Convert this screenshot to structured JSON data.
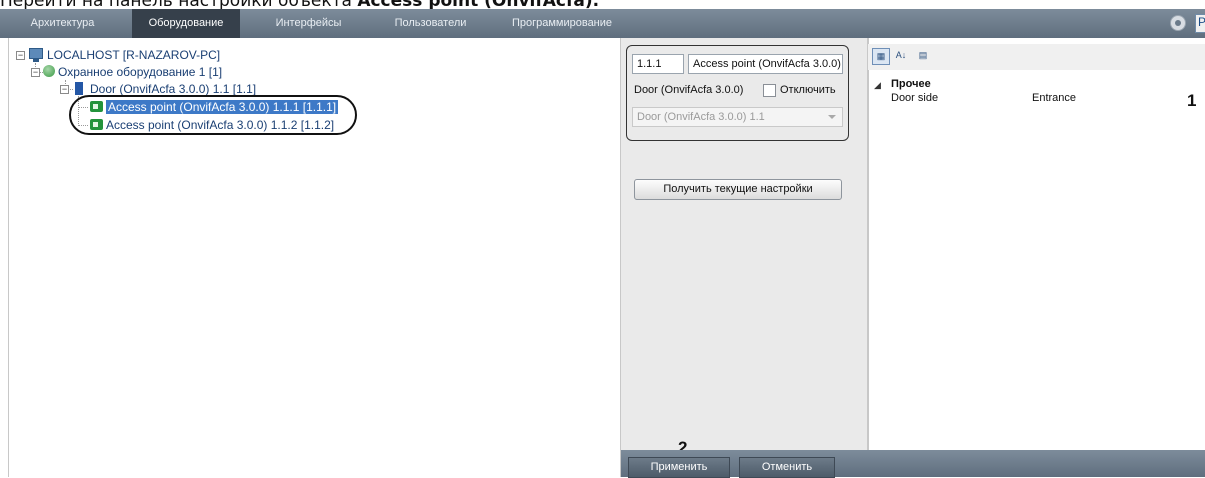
{
  "caption": {
    "prefix": "Перейти на панель настройки объекта ",
    "bold": "Access point (OnvifAcfa)."
  },
  "menubar": {
    "tabs": [
      {
        "label": "Архитектура",
        "active": false
      },
      {
        "label": "Оборудование",
        "active": true
      },
      {
        "label": "Интерфейсы",
        "active": false
      },
      {
        "label": "Пользователи",
        "active": false
      },
      {
        "label": "Программирование",
        "active": false
      }
    ],
    "corner_label": "P"
  },
  "tree": {
    "root": "LOCALHOST [R-NAZAROV-PC]",
    "equipment": "Охранное оборудование 1 [1]",
    "door": "Door (OnvifAcfa 3.0.0) 1.1 [1.1]",
    "ap1": "Access point (OnvifAcfa 3.0.0) 1.1.1 [1.1.1]",
    "ap2": "Access point (OnvifAcfa 3.0.0) 1.1.2 [1.1.2]"
  },
  "settings": {
    "id_value": "1.1.1",
    "name_value": "Access point (OnvifAcfa 3.0.0)",
    "parent_label": "Door (OnvifAcfa 3.0.0)",
    "disable_label": "Отключить",
    "parent_select": "Door (OnvifAcfa 3.0.0) 1.1",
    "get_settings_button": "Получить текущие настройки"
  },
  "properties": {
    "category": "Прочее",
    "rows": [
      {
        "name": "Door side",
        "value": "Entrance"
      }
    ]
  },
  "footer": {
    "apply_button": "Применить",
    "cancel_button": "Отменить"
  },
  "markers": {
    "one": "1",
    "two": "2"
  }
}
